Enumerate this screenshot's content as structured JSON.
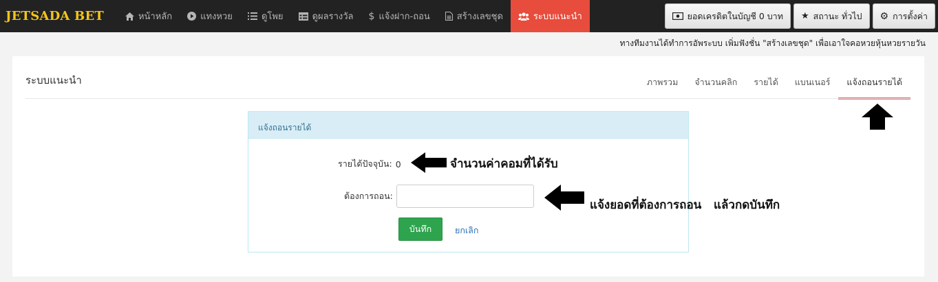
{
  "brand": "JETSADA BET",
  "nav": {
    "items": [
      {
        "label": "หน้าหลัก",
        "icon": "home-icon"
      },
      {
        "label": "แทงหวย",
        "icon": "play-circle-icon"
      },
      {
        "label": "ดูโพย",
        "icon": "list-icon"
      },
      {
        "label": "ดูผลรางวัล",
        "icon": "table-icon"
      },
      {
        "label": "แจ้งฝาก-ถอน",
        "icon": "dollar-icon"
      },
      {
        "label": "สร้างเลขชุด",
        "icon": "document-icon"
      },
      {
        "label": "ระบบแนะนำ",
        "icon": "users-icon",
        "active": true
      }
    ],
    "right": {
      "credit_label": "ยอดเครดิตในบัญชี 0 บาท",
      "status_label": "สถานะ ทั่วไป",
      "settings_label": "การตั้งค่า"
    }
  },
  "marquee": "ทางทีมงานได้ทำการอัพระบบ เพิ่มฟังชั่น \"สร้างเลขชุด\" เพื่อเอาใจคอหวยหุ้นหวยรายวัน",
  "panel": {
    "title": "ระบบแนะนำ",
    "tabs": [
      "ภาพรวม",
      "จำนวนคลิก",
      "รายได้",
      "แบนเนอร์",
      "แจ้งถอนรายได้"
    ],
    "active_tab": 4
  },
  "form": {
    "heading": "แจ้งถอนรายได้",
    "income_label": "รายได้ปัจจุบัน:",
    "income_value": "0",
    "withdraw_label": "ต้องการถอน:",
    "withdraw_value": "",
    "save_label": "บันทึก",
    "cancel_label": "ยกเลิก"
  },
  "annotations": {
    "commission_note": "จำนวนค่าคอมที่ได้รับ",
    "withdraw_note": "แจ้งยอดที่ต้องการถอน   แล้วกดบันทึก"
  },
  "colors": {
    "navbar": "#222222",
    "brand": "#f5c518",
    "active_nav": "#e74c3c",
    "tab_underline": "#e56b6f",
    "save_button": "#2ea44f",
    "info_header": "#d9edf7"
  }
}
